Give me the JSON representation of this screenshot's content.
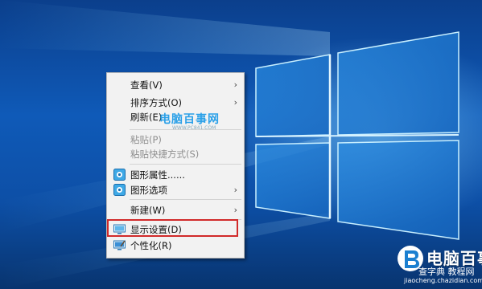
{
  "context_menu": {
    "items": [
      {
        "label": "查看(V)"
      },
      {
        "label": "排序方式(O)"
      },
      {
        "label": "刷新(E)"
      },
      {
        "label": "粘贴(P)"
      },
      {
        "label": "粘贴快捷方式(S)"
      },
      {
        "label": "图形属性......"
      },
      {
        "label": "图形选项"
      },
      {
        "label": "新建(W)"
      },
      {
        "label": "显示设置(D)"
      },
      {
        "label": "个性化(R)"
      }
    ]
  },
  "watermarks": {
    "top": {
      "text": "电脑百事网",
      "sub": "WWW.PC841.COM"
    },
    "corner": {
      "title": "电脑百事网",
      "sub": "查字典 教程网",
      "url": "jiaocheng.chazidian.com"
    }
  },
  "colors": {
    "desktop_blue": "#0d4fa6",
    "highlight_red": "#d12a2a",
    "menu_bg": "#f2f2f2"
  },
  "icons": [
    "submenu-arrow-icon",
    "graphics-properties-icon",
    "graphics-options-icon",
    "display-settings-icon",
    "personalize-icon",
    "brand-logo-icon"
  ]
}
